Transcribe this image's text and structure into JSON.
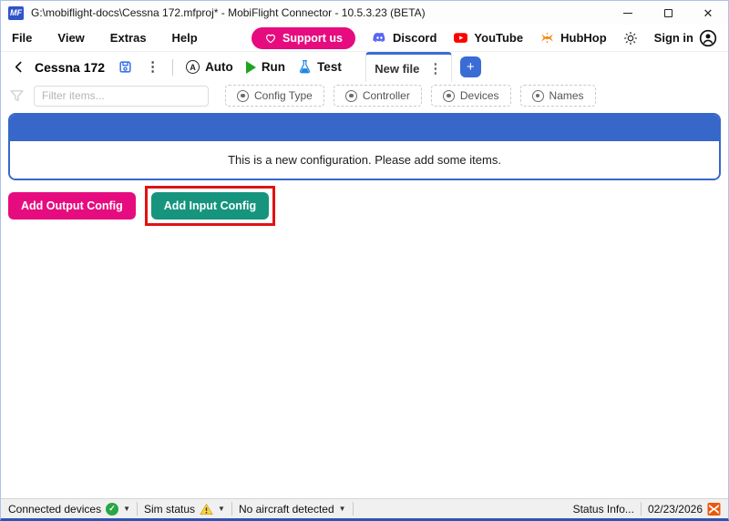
{
  "window": {
    "title": "G:\\mobiflight-docs\\Cessna 172.mfproj* - MobiFlight Connector - 10.5.3.23 (BETA)",
    "logo": "MF"
  },
  "menu": {
    "items": [
      "File",
      "View",
      "Extras",
      "Help"
    ],
    "support_us": "Support us",
    "discord": "Discord",
    "youtube": "YouTube",
    "hubhop": "HubHop",
    "sign_in": "Sign in"
  },
  "toolbar": {
    "project_name": "Cessna 172",
    "auto_label": "Auto",
    "run_label": "Run",
    "test_label": "Test",
    "auto_letter": "A"
  },
  "tabs": {
    "active_label": "New file",
    "add_button": "+"
  },
  "filter": {
    "placeholder": "Filter items...",
    "chips": [
      "Config Type",
      "Controller",
      "Devices",
      "Names"
    ]
  },
  "content": {
    "message": "This is a new configuration. Please add some items.",
    "add_output_label": "Add Output Config",
    "add_input_label": "Add Input Config"
  },
  "statusbar": {
    "connected_devices": "Connected devices",
    "sim_status": "Sim status",
    "aircraft": "No aircraft detected",
    "status_info": "Status Info...",
    "date": "02/23/2026"
  },
  "colors": {
    "accent_blue": "#3767C9",
    "tab_blue": "#3B6CD6",
    "logo_blue": "#2F54C8",
    "magenta": "#E60C7F",
    "teal": "#16947E",
    "highlight_red": "#E21212",
    "run_green": "#1FA41F",
    "test_blue": "#1E88E5",
    "save_blue": "#3D74E8",
    "discord_blurple": "#5865F2",
    "youtube_red": "#FF0000",
    "hubhop_orange": "#F6870F",
    "success_green": "#28A745",
    "warning_yellow": "#FFD43B",
    "status_orange": "#E8590C",
    "window_border_blue": "#2C55B2"
  }
}
